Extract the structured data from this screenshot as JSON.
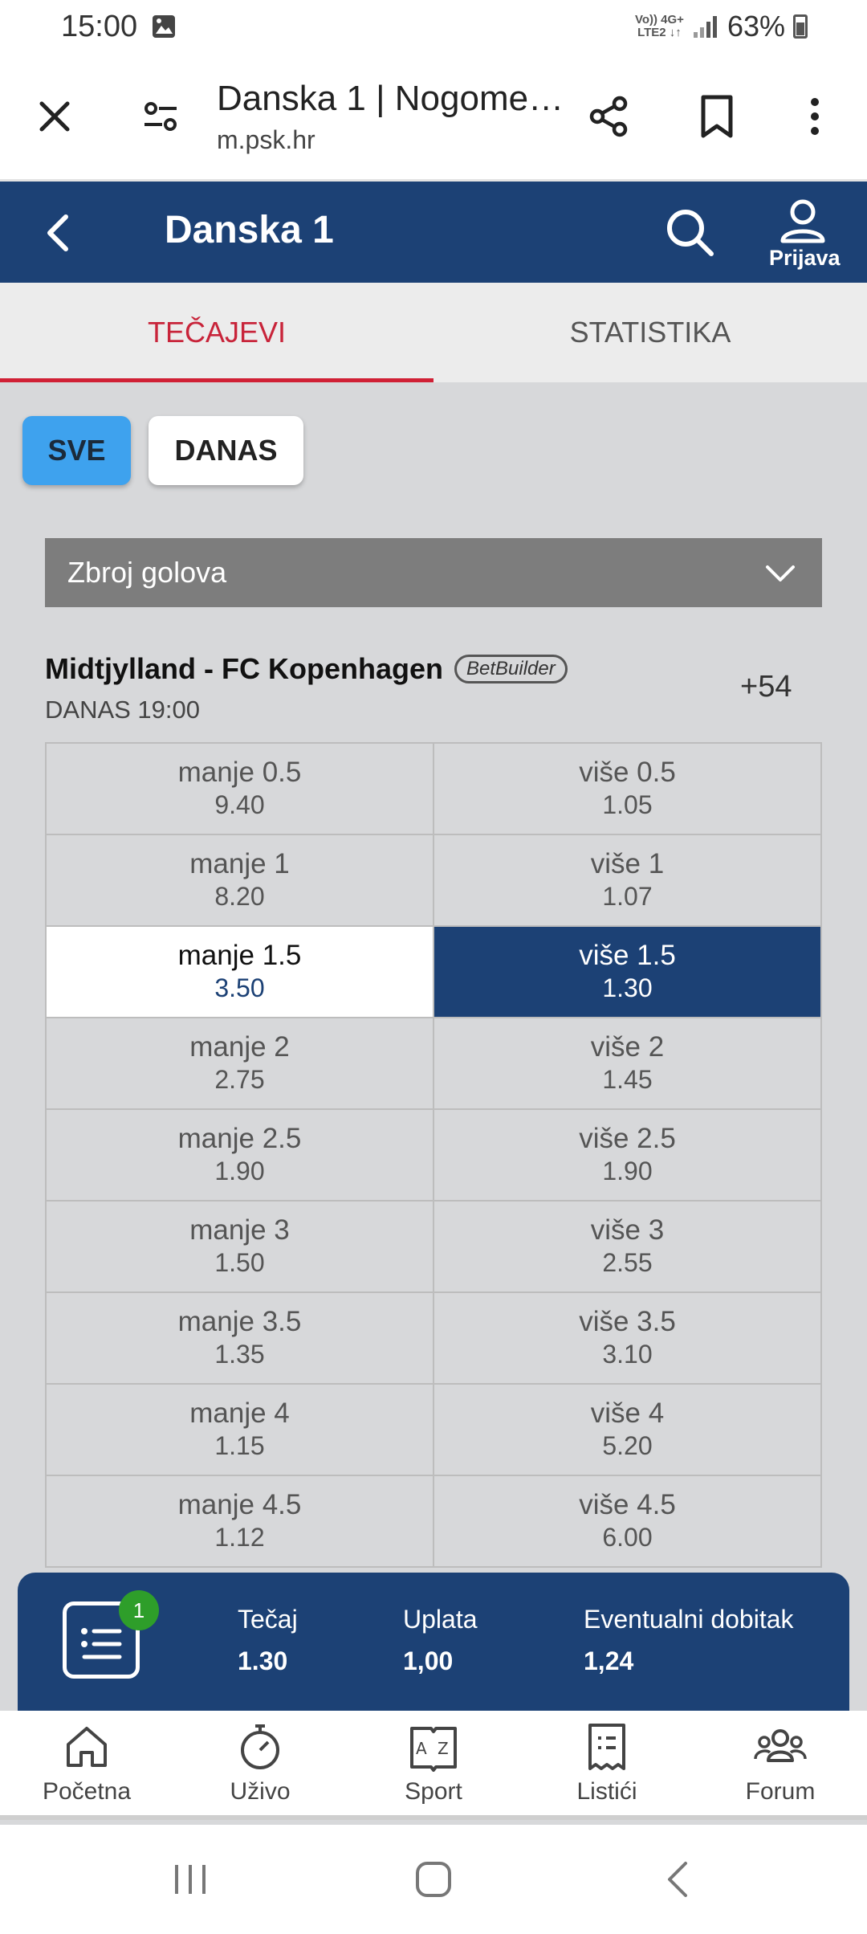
{
  "status_bar": {
    "time": "15:00",
    "network_top": "Vo)) 4G+",
    "network_bottom": "LTE2 ↓↑",
    "battery": "63%"
  },
  "browser": {
    "title": "Danska 1 | Nogome…",
    "host": "m.psk.hr"
  },
  "header": {
    "title": "Danska 1",
    "login_label": "Prijava"
  },
  "tabs": [
    {
      "label": "TEČAJEVI",
      "active": true
    },
    {
      "label": "STATISTIKA",
      "active": false
    }
  ],
  "filters": {
    "all": "SVE",
    "today": "DANAS",
    "active": "SVE"
  },
  "market_select": {
    "value": "Zbroj golova"
  },
  "match": {
    "home": "Midtjylland",
    "separator": " - ",
    "away": "FC Kopenhagen",
    "badge": "BetBuilder",
    "time": "DANAS 19:00",
    "more_markets": "+54"
  },
  "odds": [
    {
      "under_label": "manje 0.5",
      "under_odd": "9.40",
      "over_label": "više 0.5",
      "over_odd": "1.05",
      "selected": ""
    },
    {
      "under_label": "manje 1",
      "under_odd": "8.20",
      "over_label": "više 1",
      "over_odd": "1.07",
      "selected": ""
    },
    {
      "under_label": "manje 1.5",
      "under_odd": "3.50",
      "over_label": "više 1.5",
      "over_odd": "1.30",
      "selected": "over"
    },
    {
      "under_label": "manje 2",
      "under_odd": "2.75",
      "over_label": "više 2",
      "over_odd": "1.45",
      "selected": ""
    },
    {
      "under_label": "manje 2.5",
      "under_odd": "1.90",
      "over_label": "više 2.5",
      "over_odd": "1.90",
      "selected": ""
    },
    {
      "under_label": "manje 3",
      "under_odd": "1.50",
      "over_label": "više 3",
      "over_odd": "2.55",
      "selected": ""
    },
    {
      "under_label": "manje 3.5",
      "under_odd": "1.35",
      "over_label": "više 3.5",
      "over_odd": "3.10",
      "selected": ""
    },
    {
      "under_label": "manje 4",
      "under_odd": "1.15",
      "over_label": "više 4",
      "over_odd": "5.20",
      "selected": ""
    },
    {
      "under_label": "manje 4.5",
      "under_odd": "1.12",
      "over_label": "više 4.5",
      "over_odd": "6.00",
      "selected": ""
    }
  ],
  "bet_slip": {
    "count": "1",
    "odds_label": "Tečaj",
    "odds_value": "1.30",
    "stake_label": "Uplata",
    "stake_value": "1,00",
    "win_label": "Eventualni dobitak",
    "win_value": "1,24"
  },
  "bottom_nav": [
    {
      "label": "Početna",
      "icon": "home-icon"
    },
    {
      "label": "Uživo",
      "icon": "stopwatch-icon"
    },
    {
      "label": "Sport",
      "icon": "az-book-icon"
    },
    {
      "label": "Listići",
      "icon": "receipt-icon"
    },
    {
      "label": "Forum",
      "icon": "users-icon"
    }
  ],
  "colors": {
    "brand": "#1c4175",
    "accent_red": "#d02035",
    "filter_active": "#3ea2ee",
    "badge_green": "#2e9e2a"
  }
}
